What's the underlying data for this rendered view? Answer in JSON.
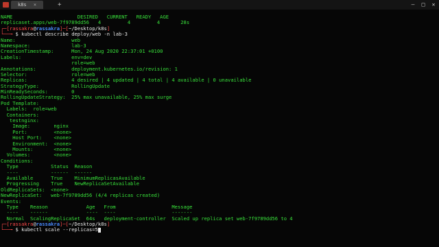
{
  "window": {
    "tab_label": "k8s",
    "tab_close": "×",
    "add_tab": "+",
    "minimize": "—",
    "maximize": "□",
    "close": "✕"
  },
  "colors": {
    "text": "#39e23b",
    "prompt_white": "#e8e8e8",
    "prompt_red": "#ff4b4b",
    "prompt_blue": "#4a8cff"
  },
  "terminal": {
    "top_rows": [
      "NAME                      DESIRED   CURRENT   READY   AGE",
      "replicaset.apps/web-7f9789dd56   4         4         4       28s"
    ],
    "prompt1": {
      "bracket_open": "┌─[",
      "user": "rassakra",
      "at": "@",
      "host": "rassakra",
      "mid": "]─[",
      "path": "~/Desktop/k8s",
      "close": "]",
      "line2": "└──╼ ",
      "dollar": "$",
      "command": "kubectl describe deploy/web -n lab-3"
    },
    "describe_rows": [
      "Name:                   web",
      "Namespace:              lab-3",
      "CreationTimestamp:      Mon, 24 Aug 2020 22:37:01 +0100",
      "Labels:                 env=dev",
      "                        role=web",
      "Annotations:            deployment.kubernetes.io/revision: 1",
      "Selector:               role=web",
      "Replicas:               4 desired | 4 updated | 4 total | 4 available | 0 unavailable",
      "StrategyType:           RollingUpdate",
      "MinReadySeconds:        0",
      "RollingUpdateStrategy:  25% max unavailable, 25% max surge",
      "Pod Template:",
      "  Labels:  role=web",
      "  Containers:",
      "   testnginx:",
      "    Image:        nginx",
      "    Port:         <none>",
      "    Host Port:    <none>",
      "    Environment:  <none>",
      "    Mounts:       <none>",
      "  Volumes:        <none>",
      "Conditions:",
      "  Type           Status  Reason",
      "  ----           ------  ------",
      "  Available      True    MinimumReplicasAvailable",
      "  Progressing    True    NewReplicaSetAvailable",
      "OldReplicaSets:  <none>",
      "NewReplicaSet:   web-7f9789dd56 (4/4 replicas created)",
      "Events:",
      "  Type    Reason             Age   From                   Message",
      "  ----    ------             ----  ----                   -------",
      "  Normal  ScalingReplicaSet  64s   deployment-controller  Scaled up replica set web-7f9789dd56 to 4"
    ],
    "prompt2": {
      "bracket_open": "┌─[",
      "user": "rassakra",
      "at": "@",
      "host": "rassakra",
      "mid": "]─[",
      "path": "~/Desktop/k8s",
      "close": "]",
      "line2": "└──╼ ",
      "dollar": "$",
      "command": "kubectl scale --replicas=5"
    }
  }
}
